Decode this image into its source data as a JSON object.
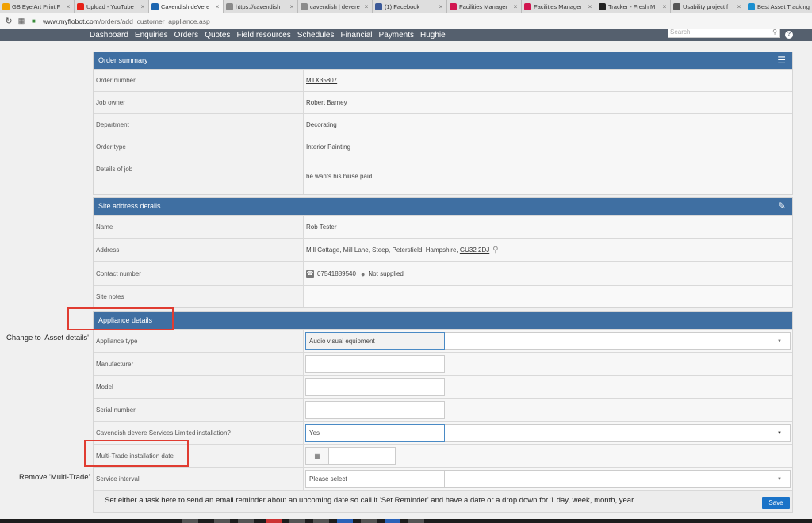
{
  "browser": {
    "tabs": [
      {
        "title": "GB Eye Art Print F",
        "icon": "amazon-icon",
        "color": "#f0a000",
        "active": false
      },
      {
        "title": "Upload - YouTube",
        "icon": "youtube-icon",
        "color": "#e62117",
        "active": false
      },
      {
        "title": "Cavendish deVere",
        "icon": "cavendish-icon",
        "color": "#1d66b0",
        "active": true
      },
      {
        "title": "https://cavendish",
        "icon": "page-icon",
        "color": "#8a8a8a",
        "active": false
      },
      {
        "title": "cavendish | devere",
        "icon": "page-icon",
        "color": "#8a8a8a",
        "active": false
      },
      {
        "title": "(1) Facebook",
        "icon": "facebook-icon",
        "color": "#3b5998",
        "active": false
      },
      {
        "title": "Facilities Manager",
        "icon": "cube-icon",
        "color": "#d1154f",
        "active": false
      },
      {
        "title": "Facilities Manager",
        "icon": "cube-icon",
        "color": "#d1154f",
        "active": false
      },
      {
        "title": "Tracker - Fresh M",
        "icon": "github-icon",
        "color": "#222222",
        "active": false
      },
      {
        "title": "Usability project f",
        "icon": "doc-icon",
        "color": "#555555",
        "active": false
      },
      {
        "title": "Best Asset Tracking",
        "icon": "c-icon",
        "color": "#1a8fd0",
        "active": false
      }
    ],
    "url_domain": "www.myflobot.com",
    "url_path": "/orders/add_customer_appliance.asp"
  },
  "nav": {
    "items": [
      "Dashboard",
      "Enquiries",
      "Orders",
      "Quotes",
      "Field resources",
      "Schedules",
      "Financial",
      "Payments",
      "Hughie"
    ],
    "search_placeholder": "Search",
    "help": "?"
  },
  "order_summary": {
    "title": "Order summary",
    "rows": [
      {
        "label": "Order number",
        "value": "MTX35807"
      },
      {
        "label": "Job owner",
        "value": "Robert Barney"
      },
      {
        "label": "Department",
        "value": "Decorating"
      },
      {
        "label": "Order type",
        "value": "Interior Painting"
      },
      {
        "label": "Details of job",
        "value": "he wants his hiuse paid"
      }
    ]
  },
  "site_address": {
    "title": "Site address details",
    "rows": {
      "name_label": "Name",
      "name_value": "Rob Tester",
      "address_label": "Address",
      "address_value": "Mill Cottage, Mill Lane, Steep, Petersfield, Hampshire,",
      "postcode": "GU32 2DJ",
      "contact_label": "Contact number",
      "phone": "07541889540",
      "mobile": "Not supplied",
      "notes_label": "Site notes",
      "notes_value": ""
    }
  },
  "appliance": {
    "title": "Appliance details",
    "type_label": "Appliance type",
    "type_value": "Audio visual equipment",
    "manufacturer_label": "Manufacturer",
    "manufacturer_value": "",
    "model_label": "Model",
    "model_value": "",
    "serial_label": "Serial number",
    "serial_value": "",
    "installation_label": "Cavendish devere Services Limited installation?",
    "installation_value": "Yes",
    "date_label": "Multi-Trade installation date",
    "date_value": "",
    "interval_label": "Service interval",
    "interval_value": "Please select"
  },
  "footer": {
    "note": "Set either a task here to send an email reminder about an upcoming date so call it 'Set Reminder' and have a date or a drop down for 1 day, week, month, year",
    "save": "Save"
  },
  "annotations": {
    "change_note": "Change to 'Asset details'",
    "remove_note": "Remove 'Multi-Trade'"
  },
  "colors": {
    "panel_header": "#3f6fa2",
    "nav_bg": "#55606e",
    "annotation": "#e03c31",
    "save_button": "#1a73c8"
  }
}
